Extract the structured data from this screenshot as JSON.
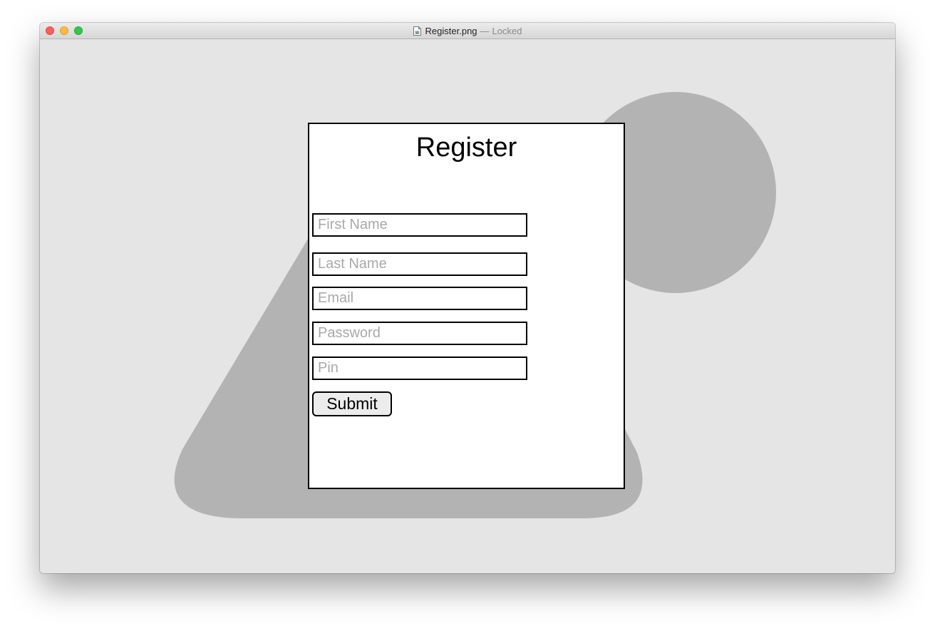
{
  "window": {
    "file_name": "Register.png",
    "separator": "—",
    "status": "Locked",
    "file_icon": "document-image-icon"
  },
  "form": {
    "title": "Register",
    "fields": {
      "first_name": {
        "value": "",
        "placeholder": "First Name"
      },
      "last_name": {
        "value": "",
        "placeholder": "Last Name"
      },
      "email": {
        "value": "",
        "placeholder": "Email"
      },
      "password": {
        "value": "",
        "placeholder": "Password"
      },
      "pin": {
        "value": "",
        "placeholder": "Pin"
      }
    },
    "submit_label": "Submit"
  },
  "colors": {
    "background": "#e5e5e5",
    "shape": "#b3b3b3",
    "card": "#ffffff",
    "border": "#000000",
    "placeholder": "#a9a9a9"
  }
}
